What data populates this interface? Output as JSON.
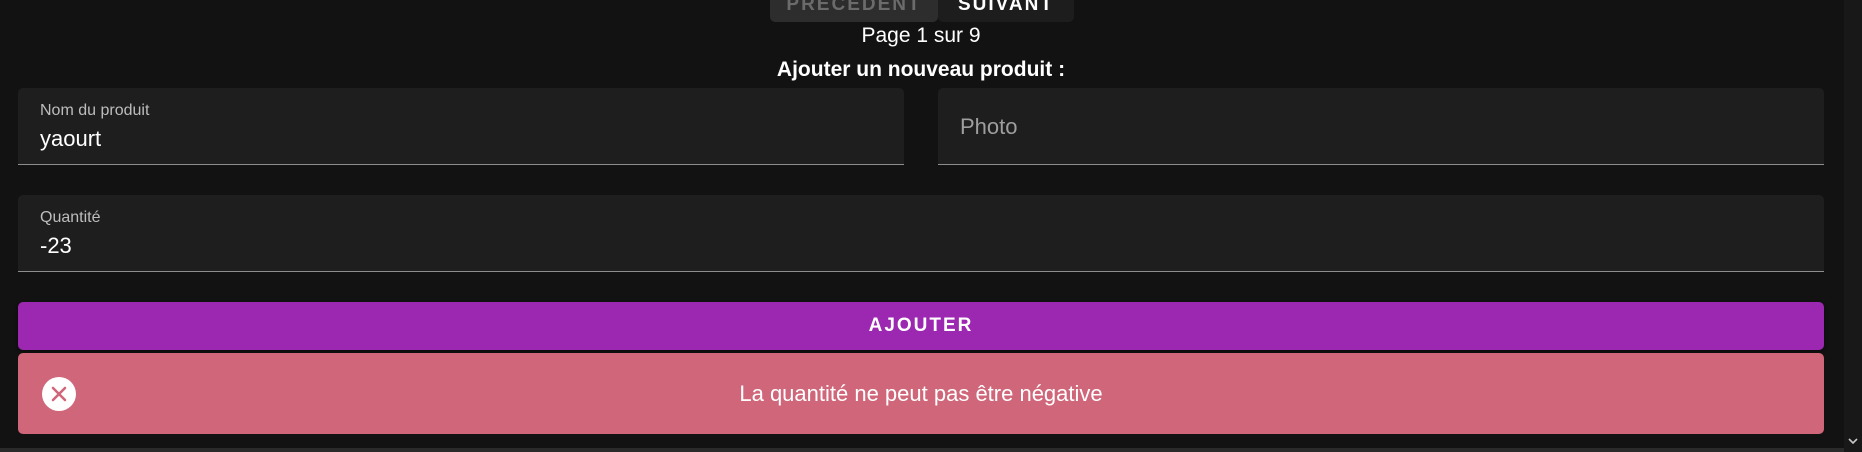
{
  "pagination": {
    "prev_label": "PRÉCÉDENT",
    "next_label": "SUIVANT",
    "page_indicator": "Page 1 sur 9"
  },
  "form": {
    "title": "Ajouter un nouveau produit :",
    "name_field": {
      "label": "Nom du produit",
      "value": "yaourt"
    },
    "photo_field": {
      "placeholder": "Photo"
    },
    "quantity_field": {
      "label": "Quantité",
      "value": "-23"
    },
    "submit_label": "AJOUTER"
  },
  "alert": {
    "message": "La quantité ne peut pas être négative",
    "icon": "close-circle-icon"
  },
  "colors": {
    "background": "#121212",
    "field_background": "#1e1e1e",
    "accent": "#9c27b0",
    "error": "#cf6679"
  }
}
